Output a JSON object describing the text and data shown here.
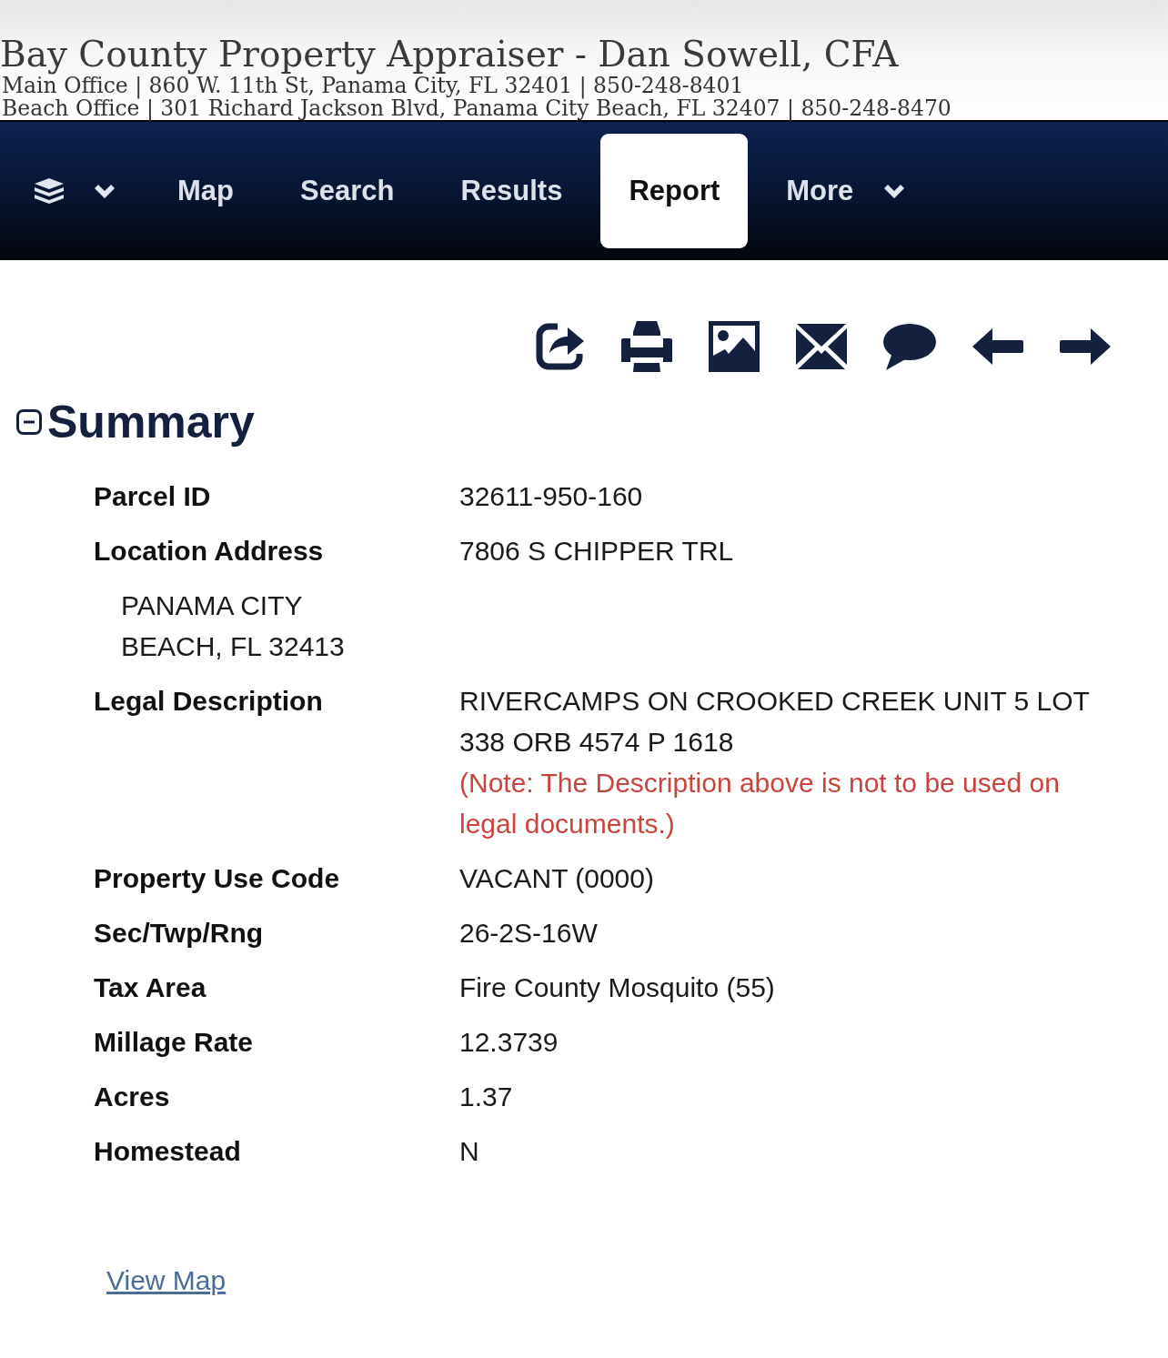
{
  "header": {
    "title": "Bay County Property Appraiser - Dan Sowell, CFA",
    "offices": [
      "Main Office | 860 W. 11th St, Panama City, FL 32401 | 850-248-8401",
      "Beach Office | 301 Richard Jackson Blvd, Panama City Beach, FL 32407 | 850-248-8470"
    ]
  },
  "nav": {
    "tabs": [
      {
        "label": "Map",
        "selected": false,
        "dropdown": false
      },
      {
        "label": "Search",
        "selected": false,
        "dropdown": false
      },
      {
        "label": "Results",
        "selected": false,
        "dropdown": false
      },
      {
        "label": "Report",
        "selected": true,
        "dropdown": false
      },
      {
        "label": "More",
        "selected": false,
        "dropdown": true
      }
    ]
  },
  "summary": {
    "title": "Summary",
    "expanded": true,
    "rows": [
      {
        "label": "Parcel ID",
        "value": "32611-950-160"
      },
      {
        "label": "Location Address",
        "value": "7806 S CHIPPER TRL",
        "continuation": "PANAMA CITY BEACH, FL 32413"
      },
      {
        "label": "Legal Description",
        "value": "RIVERCAMPS ON CROOKED CREEK UNIT 5 LOT 338 ORB 4574 P 1618",
        "note": "(Note: The Description above is not to be used on legal documents.)"
      },
      {
        "label": "Property Use Code",
        "value": "VACANT (0000)"
      },
      {
        "label": "Sec/Twp/Rng",
        "value": "26-2S-16W"
      },
      {
        "label": "Tax Area",
        "value": "Fire County Mosquito (55)"
      },
      {
        "label": "Millage Rate",
        "value": "12.3739"
      },
      {
        "label": "Acres",
        "value": "1.37"
      },
      {
        "label": "Homestead",
        "value": "N"
      }
    ]
  },
  "view_map_link": "View Map"
}
